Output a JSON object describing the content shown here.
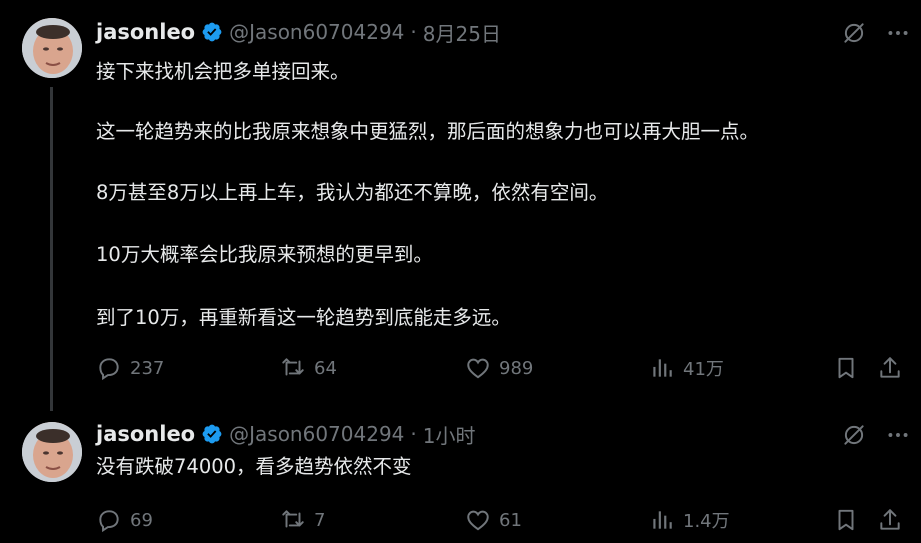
{
  "tweets": [
    {
      "author": {
        "name": "jasonleo",
        "handle": "@Jason60704294"
      },
      "time": "8月25日",
      "paragraphs": [
        "接下来找机会把多单接回来。",
        "这一轮趋势来的比我原来想象中更猛烈，那后面的想象力也可以再大胆一点。",
        "8万甚至8万以上再上车，我认为都还不算晚，依然有空间。",
        "10万大概率会比我原来预想的更早到。",
        "到了10万，再重新看这一轮趋势到底能走多远。"
      ],
      "stats": {
        "replies": "237",
        "retweets": "64",
        "likes": "989",
        "views": "41万"
      }
    },
    {
      "author": {
        "name": "jasonleo",
        "handle": "@Jason60704294"
      },
      "time": "1小时",
      "paragraphs": [
        "没有跌破74000，看多趋势依然不变"
      ],
      "stats": {
        "replies": "69",
        "retweets": "7",
        "likes": "61",
        "views": "1.4万"
      }
    }
  ],
  "separator": "·",
  "colors": {
    "background": "#000000",
    "text": "#e7e9ea",
    "muted": "#71767b",
    "verified": "#1d9bf0",
    "thread_line": "#333639"
  },
  "icons": [
    "verified-badge-icon",
    "grok-icon",
    "more-icon",
    "reply-icon",
    "retweet-icon",
    "like-icon",
    "views-icon",
    "bookmark-icon",
    "share-icon"
  ]
}
